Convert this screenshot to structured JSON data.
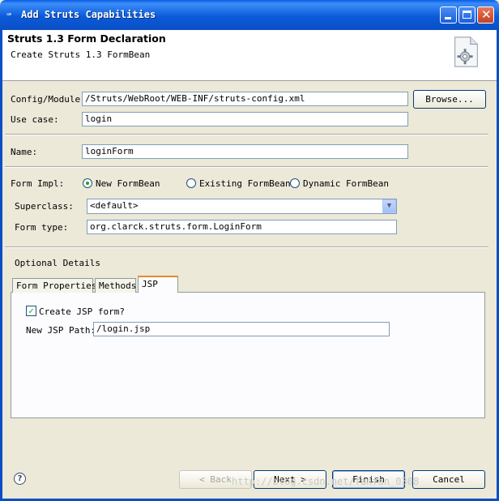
{
  "window": {
    "title": "Add Struts Capabilities",
    "icon": "arrow-icon",
    "minimize_icon": "minimize-icon",
    "maximize_icon": "maximize-icon",
    "close_icon": "close-icon"
  },
  "header": {
    "title": "Struts 1.3 Form Declaration",
    "subtitle": "Create Struts 1.3 FormBean",
    "icon": "wizard-gear-page-icon"
  },
  "form": {
    "config_label": "Config/Module:",
    "config_value": "/Struts/WebRoot/WEB-INF/struts-config.xml",
    "browse_label": "Browse...",
    "usecase_label": "Use case:",
    "usecase_value": "login",
    "name_label": "Name:",
    "name_value": "loginForm",
    "impl_label": "Form Impl:",
    "impl_options": [
      "New FormBean",
      "Existing FormBean",
      "Dynamic FormBean"
    ],
    "impl_selected": "New FormBean",
    "superclass_label": "Superclass:",
    "superclass_value": "<default>",
    "formtype_label": "Form type:",
    "formtype_value": "org.clarck.struts.form.LoginForm"
  },
  "optional": {
    "title": "Optional Details",
    "tabs": [
      "Form Properties",
      "Methods",
      "JSP"
    ],
    "active_tab": "JSP",
    "create_jsp_label": "Create JSP form?",
    "create_jsp_checked": true,
    "jsp_path_label": "New JSP Path:",
    "jsp_path_value": "/login.jsp"
  },
  "footer": {
    "help_icon": "help-icon",
    "back_label": "< Back",
    "next_label": "Next >",
    "finish_label": "Finish",
    "cancel_label": "Cancel",
    "watermark": "http://blog.csdn.net/fanfan_0308"
  },
  "colors": {
    "titlebar": "#0a5ee6",
    "dialog_bg": "#ece9d8",
    "tab_highlight": "#e68b2c",
    "radio_dot": "#21a121"
  }
}
